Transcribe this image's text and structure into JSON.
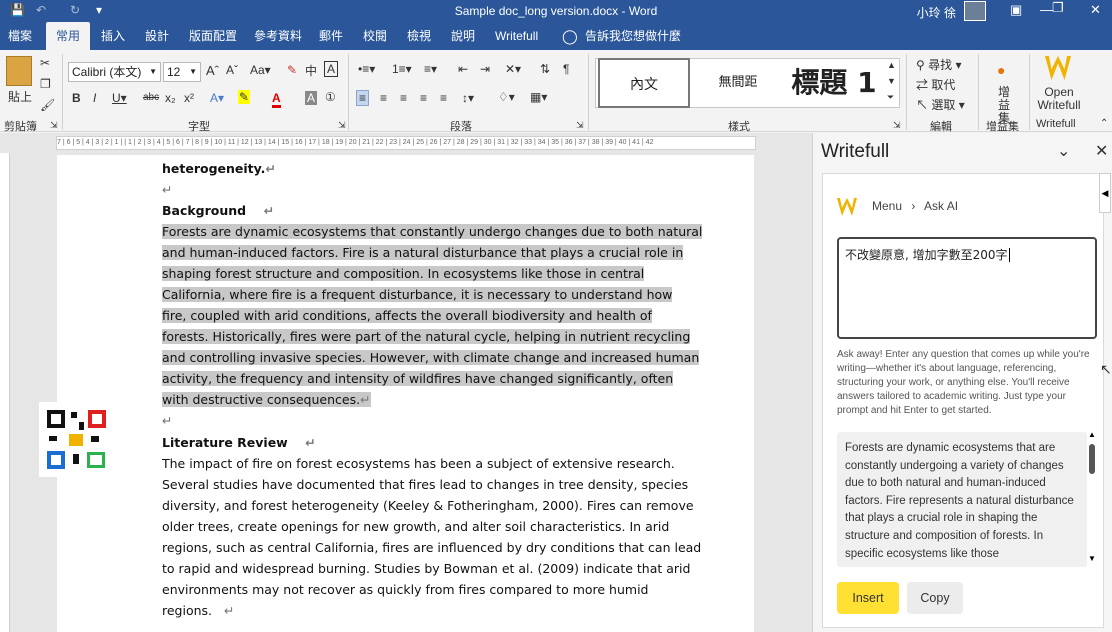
{
  "titlebar": {
    "doc_title": "Sample doc_long version.docx  -  Word",
    "user": "小玲 徐",
    "save_icon": "save-icon",
    "undo_icon": "undo-icon",
    "redo_icon": "redo-icon",
    "qat_icon": "customize-qat-icon",
    "ribbon_display_icon": "ribbon-display-icon",
    "minimize_icon": "minimize-icon",
    "restore_icon": "restore-icon",
    "close_icon": "close-icon"
  },
  "tabs": [
    "檔案",
    "常用",
    "插入",
    "設計",
    "版面配置",
    "參考資料",
    "郵件",
    "校閱",
    "檢視",
    "說明",
    "Writefull",
    "告訴我您想做什麼"
  ],
  "ribbon": {
    "clipboard": {
      "paste": "貼上",
      "label": "剪貼簿"
    },
    "font": {
      "name": "Calibri (本文)",
      "size": "12",
      "label": "字型",
      "wen_button": "中",
      "highlight_color": "#ffff00",
      "font_color": "#e00000"
    },
    "paragraph": {
      "label": "段落"
    },
    "styles": {
      "items": [
        "內文",
        "無間距",
        "標題 1"
      ],
      "label": "樣式"
    },
    "editing": {
      "find": "尋找",
      "replace": "取代",
      "select": "選取",
      "label": "編輯"
    },
    "addins": {
      "button": "增益集",
      "label": "增益集"
    },
    "writefull": {
      "button": "Open Writefull",
      "label": "Writefull"
    }
  },
  "ruler": "7 | 6 | 5 | 4 | 3 | 2 | 1 |   | 1 | 2 | 3 | 4 | 5 | 6 | 7 | 8 | 9 | 10 | 11 | 12 | 13 | 14 | 15 | 16 | 17 | 18 | 19 | 20 | 21 | 22 | 23 | 24 | 25 | 26 | 27 | 28 | 29 | 30 | 31 | 32 | 33 | 34 | 35 | 36 | 37 | 38 | 39 | 40 | 41 | 42",
  "doc": {
    "prev_line": "heterogeneity.",
    "background_heading": "Background",
    "background_lines": [
      "Forests are dynamic ecosystems that constantly undergo changes due to both natural",
      "and human-induced factors. Fire is a natural disturbance that plays a crucial role in",
      "shaping forest structure and composition. In ecosystems like those in central",
      "California, where fire is a frequent disturbance, it is necessary to understand how",
      "fire, coupled with arid conditions, affects the overall biodiversity and health of",
      "forests. Historically, fires were part of the natural cycle, helping in nutrient recycling",
      "and controlling invasive species. However, with climate change and increased human",
      "activity, the frequency and intensity of wildfires have changed significantly, often",
      "with destructive consequences."
    ],
    "lit_heading": "Literature Review",
    "lit_lines": [
      "The impact of fire on forest ecosystems has been a subject of extensive research.",
      "Several studies have documented that fires lead to changes in tree density, species",
      "diversity, and forest heterogeneity (Keeley & Fotheringham, 2000). Fires can remove",
      "older trees, create openings for new growth, and alter soil characteristics. In arid",
      "regions, such as central California, fires are influenced by dry conditions that can lead",
      "to rapid and widespread burning. Studies by Bowman et al. (2009) indicate that arid",
      "environments may not recover as quickly from fires compared to more humid",
      "regions."
    ],
    "para_mark": "↵"
  },
  "panel": {
    "title": "Writefull",
    "breadcrumb_menu": "Menu",
    "breadcrumb_sep": "›",
    "breadcrumb_current": "Ask AI",
    "prompt_value": "不改變原意, 增加字數至200字",
    "help": "Ask away! Enter any question that comes up while you're writing—whether it's about language, referencing, structuring your work, or anything else. You'll receive answers tailored to academic writing. Just type your prompt and hit Enter to get started.",
    "answer": "Forests are dynamic ecosystems that are constantly undergoing a variety of changes due to both natural and human-induced factors. Fire represents a natural disturbance that plays a crucial role in shaping the structure and composition of forests. In specific ecosystems like those",
    "insert": "Insert",
    "copy": "Copy"
  }
}
